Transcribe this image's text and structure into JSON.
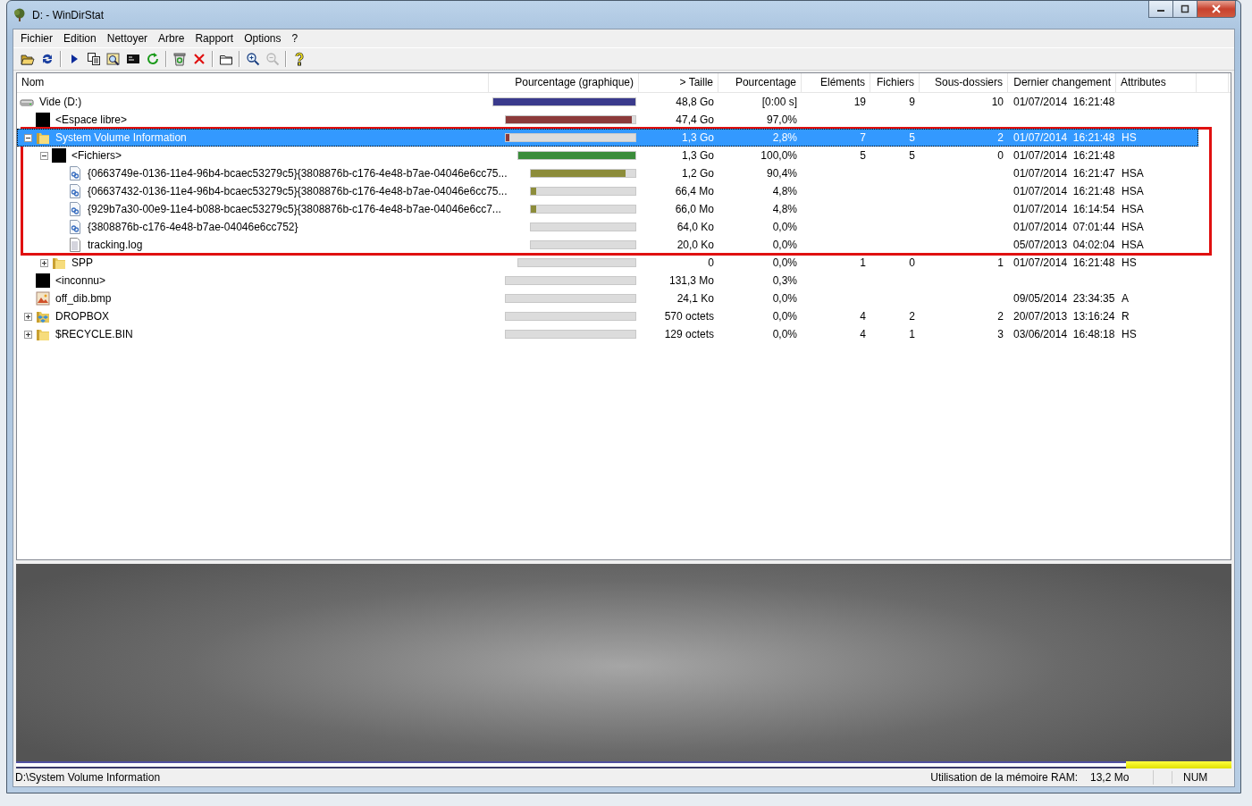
{
  "window": {
    "title": "D: - WinDirStat"
  },
  "menu": [
    "Fichier",
    "Edition",
    "Nettoyer",
    "Arbre",
    "Rapport",
    "Options",
    "?"
  ],
  "toolbar": [
    {
      "kind": "open",
      "disabled": false
    },
    {
      "kind": "rescan",
      "disabled": false
    },
    {
      "kind": "sep"
    },
    {
      "kind": "play",
      "disabled": false
    },
    {
      "kind": "copy",
      "disabled": false
    },
    {
      "kind": "explorer",
      "disabled": false
    },
    {
      "kind": "console",
      "disabled": false
    },
    {
      "kind": "refresh",
      "disabled": false
    },
    {
      "kind": "sep"
    },
    {
      "kind": "recycle",
      "disabled": false
    },
    {
      "kind": "delete",
      "disabled": false
    },
    {
      "kind": "sep"
    },
    {
      "kind": "folder",
      "disabled": false
    },
    {
      "kind": "sep"
    },
    {
      "kind": "zoomin",
      "disabled": false
    },
    {
      "kind": "zoomout",
      "disabled": true
    },
    {
      "kind": "sep"
    },
    {
      "kind": "help",
      "disabled": false
    }
  ],
  "columns": [
    "Nom",
    "Pourcentage (graphique)",
    "> Taille",
    "Pourcentage",
    "Eléments",
    "Fichiers",
    "Sous-dossiers",
    "Dernier changement",
    "Attributes"
  ],
  "tree": [
    {
      "name": "Vide (D:)",
      "kind": "drive",
      "selected": false,
      "bar": {
        "level": 1,
        "color": "#3a3a8c"
      },
      "size": "48,8 Go",
      "percent": "[0:00 s]",
      "items": "19",
      "files": "9",
      "subdirs": "10",
      "date": "01/07/2014  16:21:48",
      "children": [
        {
          "name": "<Espace libre>",
          "kind": "block",
          "selected": false,
          "bar": {
            "level": 0.97,
            "color": "#8c3a3a"
          },
          "size": "47,4 Go",
          "percent": "97,0%"
        },
        {
          "name": "System Volume Information",
          "kind": "folder",
          "selected": true,
          "expanded": true,
          "bar": {
            "level": 0.028,
            "color": "#8c3a3a"
          },
          "size": "1,3 Go",
          "percent": "2,8%",
          "items": "7",
          "files": "5",
          "subdirs": "2",
          "date": "01/07/2014  16:21:48",
          "attributes": "HS",
          "children": [
            {
              "name": "<Fichiers>",
              "kind": "block",
              "selected": false,
              "expanded": true,
              "bar": {
                "level": 1,
                "color": "#3a8c3a"
              },
              "size": "1,3 Go",
              "percent": "100,0%",
              "items": "5",
              "files": "5",
              "subdirs": "0",
              "date": "01/07/2014  16:21:48",
              "children": [
                {
                  "name": "{0663749e-0136-11e4-96b4-bcaec53279c5}{3808876b-c176-4e48-b7ae-04046e6cc75...",
                  "kind": "linkfile",
                  "selected": false,
                  "bar": {
                    "level": 0.904,
                    "color": "#8c8c3a"
                  },
                  "size": "1,2 Go",
                  "percent": "90,4%",
                  "date": "01/07/2014  16:21:47",
                  "attributes": "HSA"
                },
                {
                  "name": "{06637432-0136-11e4-96b4-bcaec53279c5}{3808876b-c176-4e48-b7ae-04046e6cc75...",
                  "kind": "linkfile",
                  "selected": false,
                  "bar": {
                    "level": 0.048,
                    "color": "#8c8c3a"
                  },
                  "size": "66,4 Mo",
                  "percent": "4,8%",
                  "date": "01/07/2014  16:21:48",
                  "attributes": "HSA"
                },
                {
                  "name": "{929b7a30-00e9-11e4-b088-bcaec53279c5}{3808876b-c176-4e48-b7ae-04046e6cc7...",
                  "kind": "linkfile",
                  "selected": false,
                  "bar": {
                    "level": 0.048,
                    "color": "#8c8c3a"
                  },
                  "size": "66,0 Mo",
                  "percent": "4,8%",
                  "date": "01/07/2014  16:14:54",
                  "attributes": "HSA"
                },
                {
                  "name": "{3808876b-c176-4e48-b7ae-04046e6cc752}",
                  "kind": "linkfile",
                  "selected": false,
                  "size": "64,0 Ko",
                  "percent": "0,0%",
                  "date": "01/07/2014  07:01:44",
                  "attributes": "HSA"
                },
                {
                  "name": "tracking.log",
                  "kind": "textfile",
                  "selected": false,
                  "size": "20,0 Ko",
                  "percent": "0,0%",
                  "date": "05/07/2013  04:02:04",
                  "attributes": "HSA"
                }
              ]
            },
            {
              "name": "SPP",
              "kind": "folder",
              "selected": false,
              "expanded": false,
              "size": "0",
              "percent": "0,0%",
              "items": "1",
              "files": "0",
              "subdirs": "1",
              "date": "01/07/2014  16:21:48",
              "attributes": "HS"
            }
          ]
        },
        {
          "name": "<inconnu>",
          "kind": "block",
          "selected": false,
          "size": "131,3 Mo",
          "percent": "0,3%"
        },
        {
          "name": "off_dib.bmp",
          "kind": "image",
          "selected": false,
          "size": "24,1 Ko",
          "percent": "0,0%",
          "date": "09/05/2014  23:34:35",
          "attributes": "A"
        },
        {
          "name": "DROPBOX",
          "kind": "dropbox",
          "selected": false,
          "expanded": false,
          "size": "570 octets",
          "percent": "0,0%",
          "items": "4",
          "files": "2",
          "subdirs": "2",
          "date": "20/07/2013  13:16:24",
          "attributes": "R"
        },
        {
          "name": "$RECYCLE.BIN",
          "kind": "folder",
          "selected": false,
          "expanded": false,
          "size": "129 octets",
          "percent": "0,0%",
          "items": "4",
          "files": "1",
          "subdirs": "3",
          "date": "03/06/2014  16:48:18",
          "attributes": "HS"
        }
      ]
    }
  ],
  "status_bar": {
    "path": "D:\\System Volume Information",
    "memory_label": "Utilisation de la mémoire RAM:",
    "memory_value": "13,2 Mo",
    "num": "NUM"
  }
}
